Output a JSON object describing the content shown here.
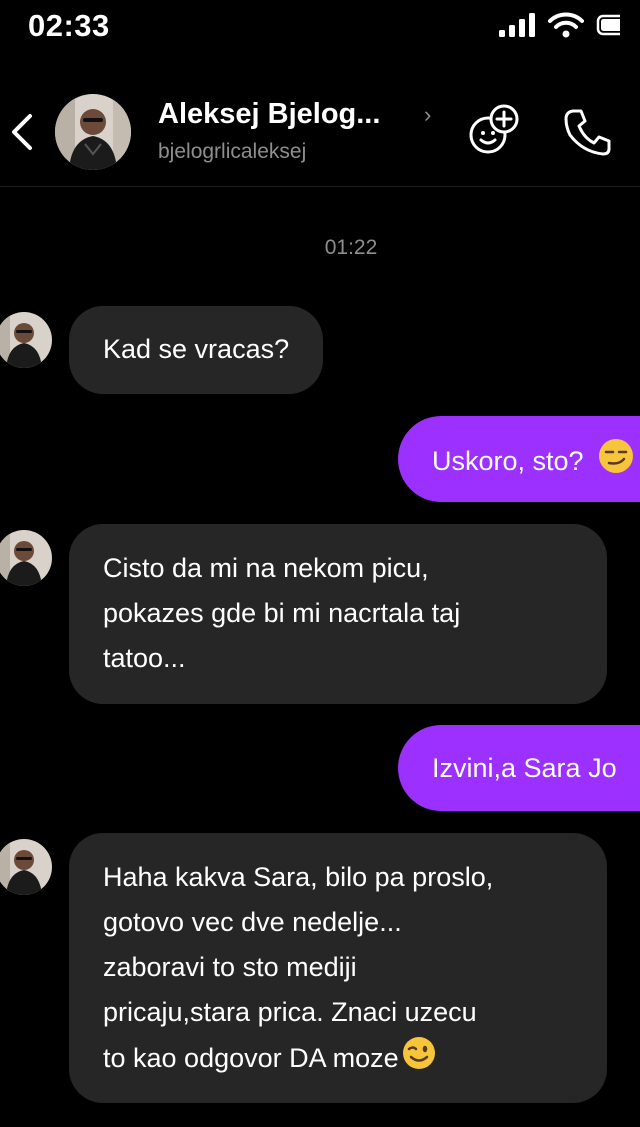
{
  "status_bar": {
    "time": "02:33"
  },
  "header": {
    "name": "Aleksej Bjelog...",
    "handle": "bjelogrlicaleksej"
  },
  "conversation": {
    "timestamp": "01:22",
    "messages": [
      {
        "direction": "incoming",
        "lines": [
          "Kad se vracas?"
        ]
      },
      {
        "direction": "outgoing",
        "lines": [
          "Uskoro, sto?"
        ],
        "emoji": "smirking-face-emoji"
      },
      {
        "direction": "incoming",
        "lines": [
          "Cisto da mi na nekom picu,",
          "pokazes gde bi mi nacrtala taj",
          "tatoo..."
        ]
      },
      {
        "direction": "outgoing",
        "lines": [
          "Izvini,a Sara Jo"
        ]
      },
      {
        "direction": "incoming",
        "lines": [
          "Haha kakva Sara, bilo pa proslo,",
          "gotovo vec dve nedelje...",
          "zaboravi to sto mediji",
          "pricaju,stara prica. Znaci uzecu",
          "to kao odgovor DA moze"
        ],
        "emoji": "winking-face-emoji"
      }
    ]
  },
  "colors": {
    "outgoing_bubble": "#9b30ff",
    "incoming_bubble": "#262626",
    "muted_text": "#8e8e8e"
  }
}
